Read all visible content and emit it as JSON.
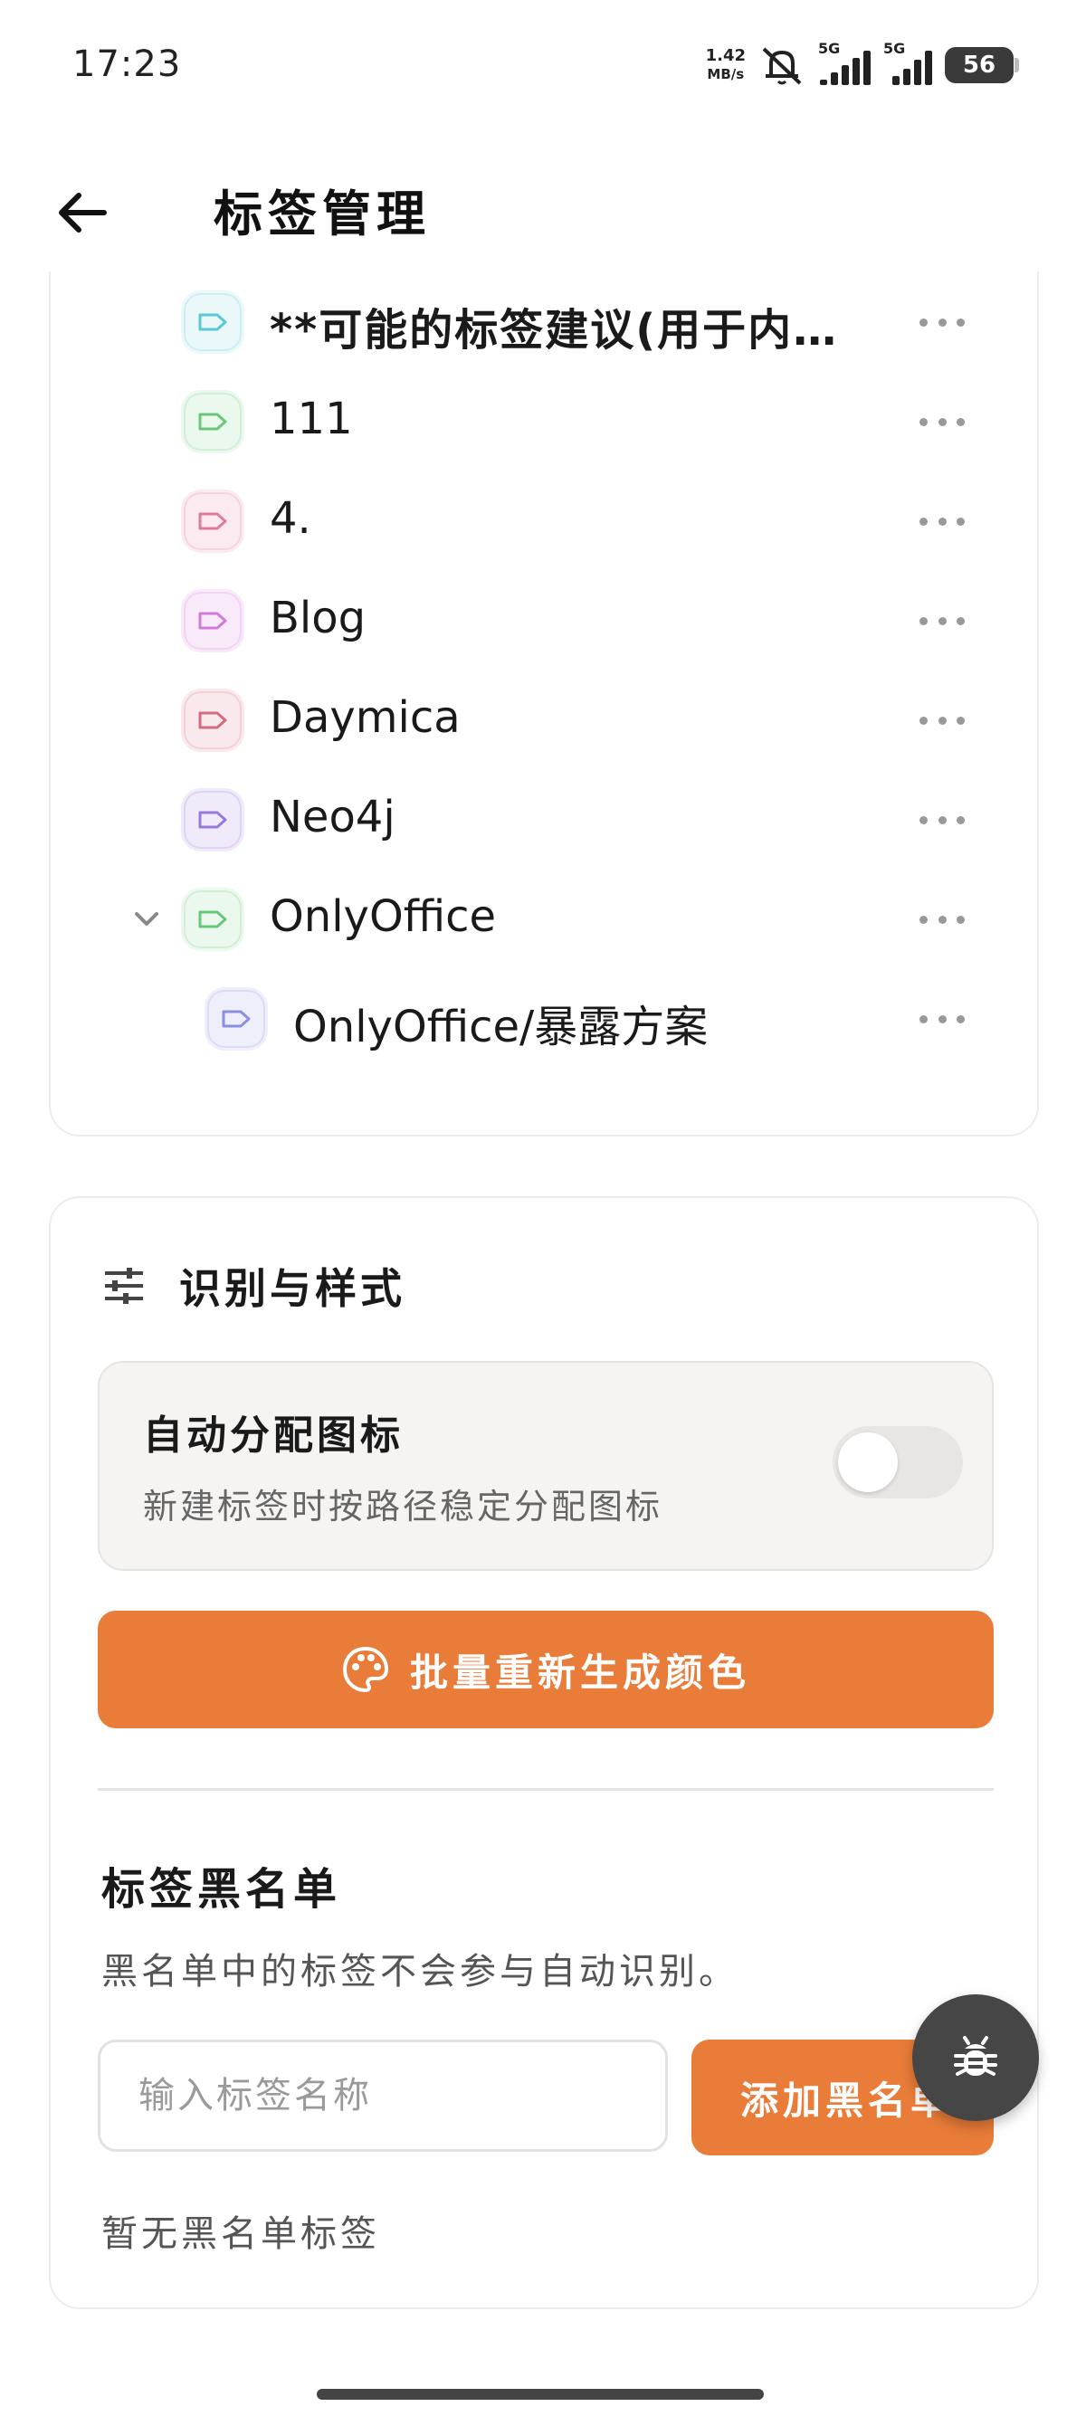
{
  "status_bar": {
    "time": "17:23",
    "net_speed_value": "1.42",
    "net_speed_unit": "MB/s",
    "sim1_label": "5G",
    "sim2_label": "5G",
    "battery": "56",
    "icons": [
      "bell-muted-icon",
      "signal-icon",
      "signal-icon",
      "battery-icon"
    ]
  },
  "header": {
    "title": "标签管理",
    "back_icon": "arrow-left-icon"
  },
  "tags": [
    {
      "label": "**可能的标签建议(用于内…",
      "color": "#5bc7d6",
      "bg": "#eaf8fa",
      "bold": true,
      "level": 1
    },
    {
      "label": "111",
      "color": "#69c77a",
      "bg": "#ebf8ee",
      "bold": false,
      "level": 1
    },
    {
      "label": "4.",
      "color": "#e07a99",
      "bg": "#fbeaf0",
      "bold": false,
      "level": 1
    },
    {
      "label": "Blog",
      "color": "#d47ad9",
      "bg": "#f9eafa",
      "bold": false,
      "level": 1
    },
    {
      "label": "Daymica",
      "color": "#d66b7d",
      "bg": "#fae9ec",
      "bold": false,
      "level": 1
    },
    {
      "label": "Neo4j",
      "color": "#9a7ad9",
      "bg": "#f0eafa",
      "bold": false,
      "level": 1
    },
    {
      "label": "OnlyOffice",
      "color": "#69c77a",
      "bg": "#ebf8ee",
      "bold": false,
      "level": 1,
      "expanded": true
    },
    {
      "label": "OnlyOffice/暴露方案",
      "color": "#8a8fe0",
      "bg": "#eeeffb",
      "bold": false,
      "level": 2
    }
  ],
  "style_section": {
    "title": "识别与样式",
    "icon": "sliders-icon",
    "auto_assign": {
      "title": "自动分配图标",
      "description": "新建标签时按路径稳定分配图标",
      "enabled": false
    },
    "regen_button": "批量重新生成颜色",
    "regen_icon": "palette-icon",
    "accent_color": "#e97c38"
  },
  "blacklist": {
    "title": "标签黑名单",
    "description": "黑名单中的标签不会参与自动识别。",
    "input_placeholder": "输入标签名称",
    "add_button": "添加黑名单",
    "empty_text": "暂无黑名单标签"
  },
  "fab": {
    "icon": "bug-icon"
  }
}
